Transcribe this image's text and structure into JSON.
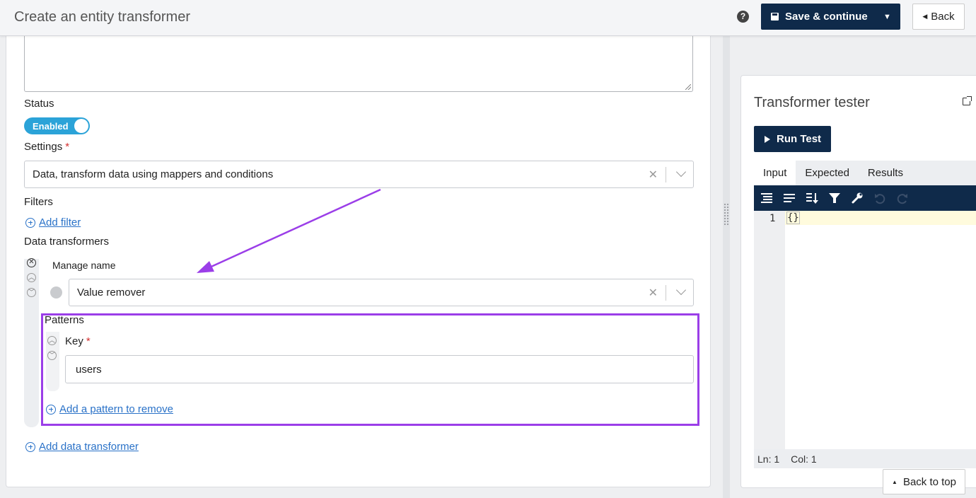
{
  "header": {
    "title": "Create an entity transformer",
    "help_glyph": "?",
    "save_label": "Save & continue",
    "back_label": "Back"
  },
  "form": {
    "status_label": "Status",
    "status_toggle": "Enabled",
    "settings_label": "Settings",
    "settings_value": "Data, transform data using mappers and conditions",
    "filters_label": "Filters",
    "add_filter": "Add filter",
    "data_transformers_label": "Data transformers",
    "manage_name_label": "Manage name",
    "transformer_value": "Value remover",
    "patterns_label": "Patterns",
    "key_label": "Key",
    "key_value": "users",
    "add_pattern": "Add a pattern to remove",
    "add_data_transformer": "Add data transformer",
    "required_mark": "*"
  },
  "tester": {
    "title": "Transformer tester",
    "run_label": "Run Test",
    "tabs": [
      "Input",
      "Expected",
      "Results"
    ],
    "active_tab": "Input",
    "line_number": "1",
    "code": "{}",
    "status_ln": "Ln: 1",
    "status_col": "Col: 1"
  },
  "back_to_top": "Back to top",
  "colors": {
    "primary_dark": "#0f2a4a",
    "toggle_blue": "#2ba3d8",
    "link_blue": "#2a72c8",
    "highlight_purple": "#9b3ee8",
    "required_red": "#d32f2f"
  }
}
